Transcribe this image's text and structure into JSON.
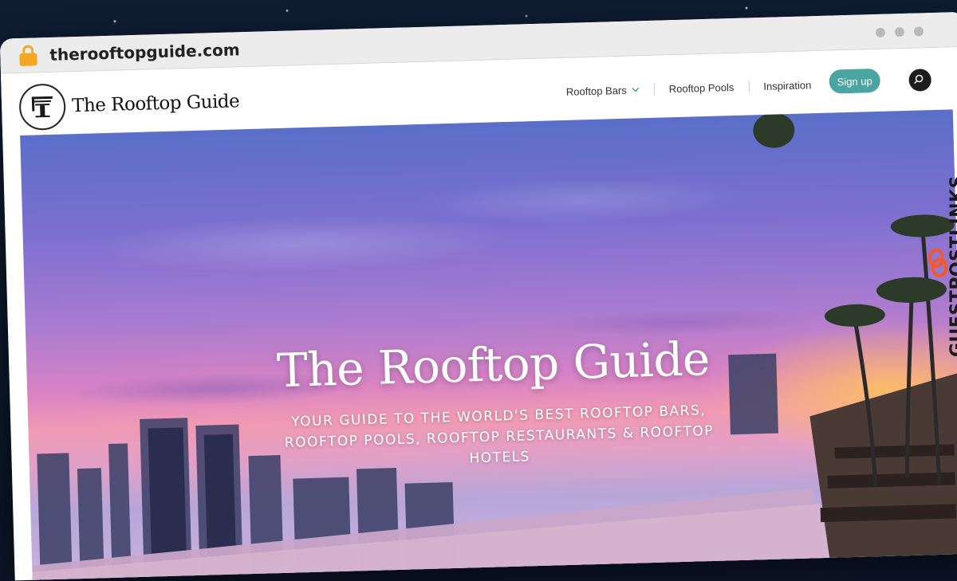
{
  "browser": {
    "url": "therooftopguide.com",
    "icons": {
      "lock": "lock-icon",
      "window_dots": "window-dots-icon"
    }
  },
  "header": {
    "logo_text": "The Rooftop Guide",
    "nav": [
      {
        "label": "Rooftop Bars",
        "has_dropdown": true
      },
      {
        "label": "Rooftop Pools",
        "has_dropdown": false
      },
      {
        "label": "Inspiration",
        "has_dropdown": false
      }
    ],
    "signup_label": "Sign up",
    "search_icon": "search-icon"
  },
  "hero": {
    "title": "The Rooftop Guide",
    "subtitle": "YOUR GUIDE TO THE WORLD'S BEST ROOFTOP BARS, ROOFTOP POOLS, ROOFTOP RESTAURANTS & ROOFTOP HOTELS"
  },
  "watermark": {
    "text": "GUESTPOSTLINKS",
    "icon": "link-icon"
  },
  "colors": {
    "accent": "#4aa5a0",
    "lock": "#f5a623",
    "watermark_icon": "#f25a29"
  }
}
